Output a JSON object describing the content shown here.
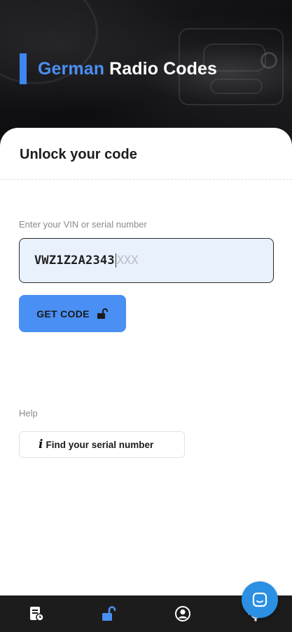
{
  "header": {
    "title_accent": "German",
    "title_rest": "Radio Codes",
    "accent_color": "#4a8ff3"
  },
  "card": {
    "title": "Unlock your code"
  },
  "vin": {
    "label": "Enter your VIN or serial number",
    "value": "VWZ1Z2A2343",
    "placeholder_remainder": "XXX"
  },
  "actions": {
    "get_code_label": "GET CODE",
    "get_code_icon": "unlock-icon"
  },
  "help": {
    "label": "Help",
    "find_serial_icon": "i",
    "find_serial_label": "Find your serial number"
  },
  "bottom_nav": {
    "items": [
      {
        "name": "receipt-history",
        "icon": "receipt-icon",
        "active": false
      },
      {
        "name": "unlock",
        "icon": "unlock-icon",
        "active": true
      },
      {
        "name": "account",
        "icon": "user-circle-icon",
        "active": false
      },
      {
        "name": "settings",
        "icon": "gear-icon",
        "active": false
      }
    ],
    "active_color": "#4a8ff3",
    "inactive_color": "#ffffff"
  },
  "chat_fab": {
    "icon": "chat-icon",
    "color": "#2b8fe3"
  }
}
